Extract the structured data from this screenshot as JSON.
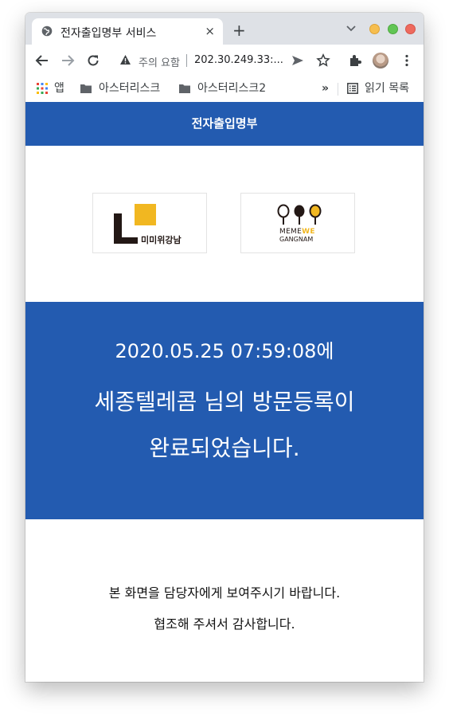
{
  "browser": {
    "tab": {
      "title": "전자출입명부 서비스",
      "favicon_icon": "globe-icon",
      "close_label": "×"
    },
    "new_tab_label": "+",
    "omnibox": {
      "security_label": "주의 요함",
      "url": "202.30.249.33:..."
    },
    "bookmarks": {
      "items": [
        {
          "label": "앱",
          "icon": "apps-grid-icon"
        },
        {
          "label": "아스터리스크",
          "icon": "folder-icon"
        },
        {
          "label": "아스터리스크2",
          "icon": "folder-icon"
        }
      ],
      "overflow_label": "»",
      "reading_list_label": "읽기 목록"
    }
  },
  "page": {
    "header_title": "전자출입명부",
    "logos": {
      "left_text": "미미위강남",
      "right_text_line1_a": "MEME",
      "right_text_line1_b": "WE",
      "right_text_line2": "GANGNAM"
    },
    "banner": {
      "timestamp_line": "2020.05.25 07:59:08에",
      "message_line1": "세종텔레콤 님의 방문등록이",
      "message_line2": "완료되었습니다."
    },
    "notice": {
      "line1": "본 화면을 담당자에게 보여주시기 바랍니다.",
      "line2": "협조해 주셔서 감사합니다."
    }
  },
  "colors": {
    "brand_blue": "#235bb0",
    "logo_yellow": "#f1b721",
    "logo_dark": "#231815"
  }
}
